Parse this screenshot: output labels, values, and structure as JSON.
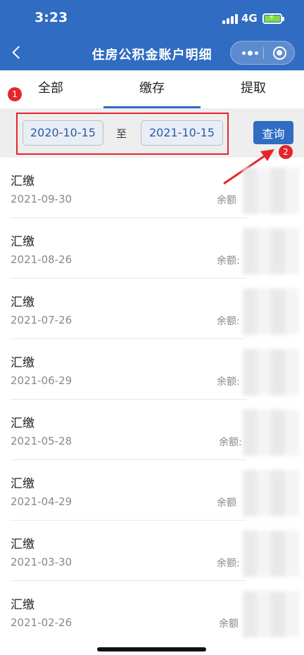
{
  "status_bar": {
    "time": "3:23",
    "network": "4G"
  },
  "nav": {
    "title": "住房公积金账户明细"
  },
  "tabs": [
    {
      "label": "全部",
      "active": false
    },
    {
      "label": "缴存",
      "active": true
    },
    {
      "label": "提取",
      "active": false
    }
  ],
  "filter": {
    "from_date": "2020-10-15",
    "to_label": "至",
    "to_date": "2021-10-15",
    "query_label": "查询"
  },
  "annotations": {
    "badge1": "1",
    "badge2": "2",
    "highlight_color": "#e4262b"
  },
  "records": [
    {
      "type": "汇缴",
      "date": "2021-09-30",
      "balance_label": "余额"
    },
    {
      "type": "汇缴",
      "date": "2021-08-26",
      "balance_label": "余额:"
    },
    {
      "type": "汇缴",
      "date": "2021-07-26",
      "balance_label": "余额:"
    },
    {
      "type": "汇缴",
      "date": "2021-06-29",
      "balance_label": "余额:"
    },
    {
      "type": "汇缴",
      "date": "2021-05-28",
      "balance_label": "余额:"
    },
    {
      "type": "汇缴",
      "date": "2021-04-29",
      "balance_label": "余额"
    },
    {
      "type": "汇缴",
      "date": "2021-03-30",
      "balance_label": "余额:"
    },
    {
      "type": "汇缴",
      "date": "2021-02-26",
      "balance_label": "余额"
    }
  ],
  "colors": {
    "primary": "#2f6cc2",
    "filter_bg": "#eeeeee",
    "date_text": "#2a5ca8",
    "badge": "#e4262b"
  },
  "icons": [
    "back-icon",
    "more-icon",
    "close-icon",
    "signal-icon",
    "battery-icon"
  ]
}
